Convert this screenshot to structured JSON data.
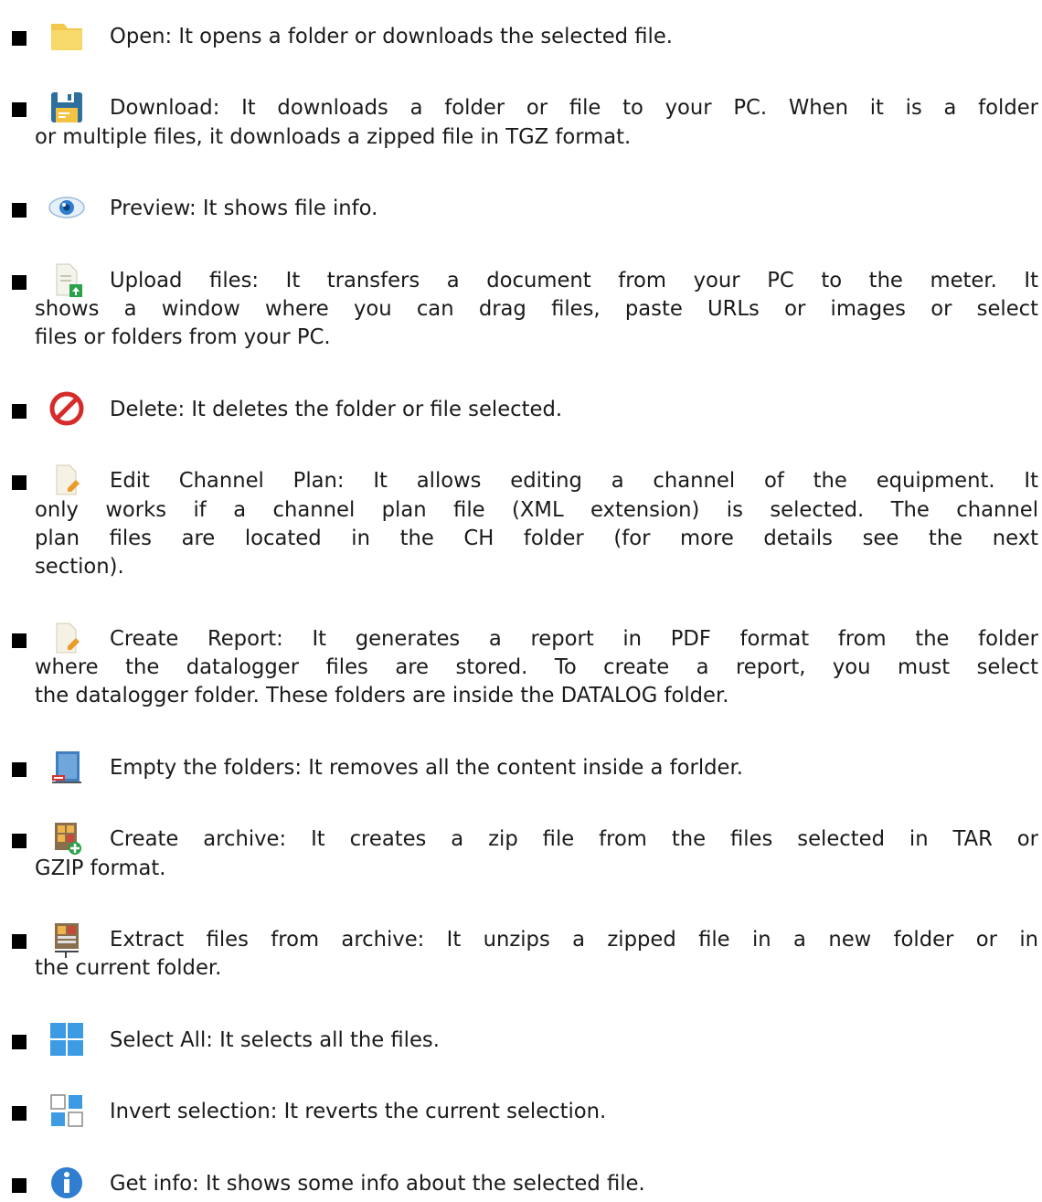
{
  "items": [
    {
      "icon": "folder-icon",
      "lines": [
        "Open: It opens a folder or downloads the selected file."
      ]
    },
    {
      "icon": "floppy-disk-icon",
      "lines": [
        "Download: It downloads a folder or file to your PC. When it is a folder",
        "or multiple files, it downloads a zipped file in TGZ format."
      ]
    },
    {
      "icon": "eye-icon",
      "lines": [
        "Preview: It shows file info."
      ]
    },
    {
      "icon": "upload-file-icon",
      "lines": [
        "Upload files: It transfers a document from your PC to the meter. It",
        "shows a window where you can drag files, paste URLs or images or select",
        "files or folders from your PC."
      ]
    },
    {
      "icon": "delete-icon",
      "lines": [
        "Delete: It deletes the folder or file selected."
      ]
    },
    {
      "icon": "edit-document-icon",
      "lines": [
        "Edit Channel Plan: It allows editing a channel of the equipment. It",
        "only works if a channel plan file (XML extension) is selected. The channel",
        "plan files are located in the CH folder (for more details see the next",
        "section)."
      ]
    },
    {
      "icon": "report-document-icon",
      "lines": [
        "Create Report: It generates a report in PDF format from the folder",
        "where the datalogger files are stored. To create a report, you must select",
        "the datalogger folder. These folders are inside the DATALOG folder."
      ]
    },
    {
      "icon": "empty-folder-icon",
      "lines": [
        "Empty the folders: It removes all the content inside a forlder."
      ]
    },
    {
      "icon": "create-archive-icon",
      "lines": [
        "Create archive: It creates a zip file from the files selected in TAR or",
        "GZIP format."
      ]
    },
    {
      "icon": "extract-archive-icon",
      "lines": [
        "Extract files from archive: It unzips a zipped file in a new folder or in",
        "the current folder."
      ]
    },
    {
      "icon": "select-all-icon",
      "lines": [
        "Select All: It selects all the files."
      ]
    },
    {
      "icon": "invert-selection-icon",
      "lines": [
        "Invert selection: It reverts the current selection."
      ]
    },
    {
      "icon": "info-icon",
      "lines": [
        "Get info: It shows some info about the selected file."
      ]
    }
  ]
}
